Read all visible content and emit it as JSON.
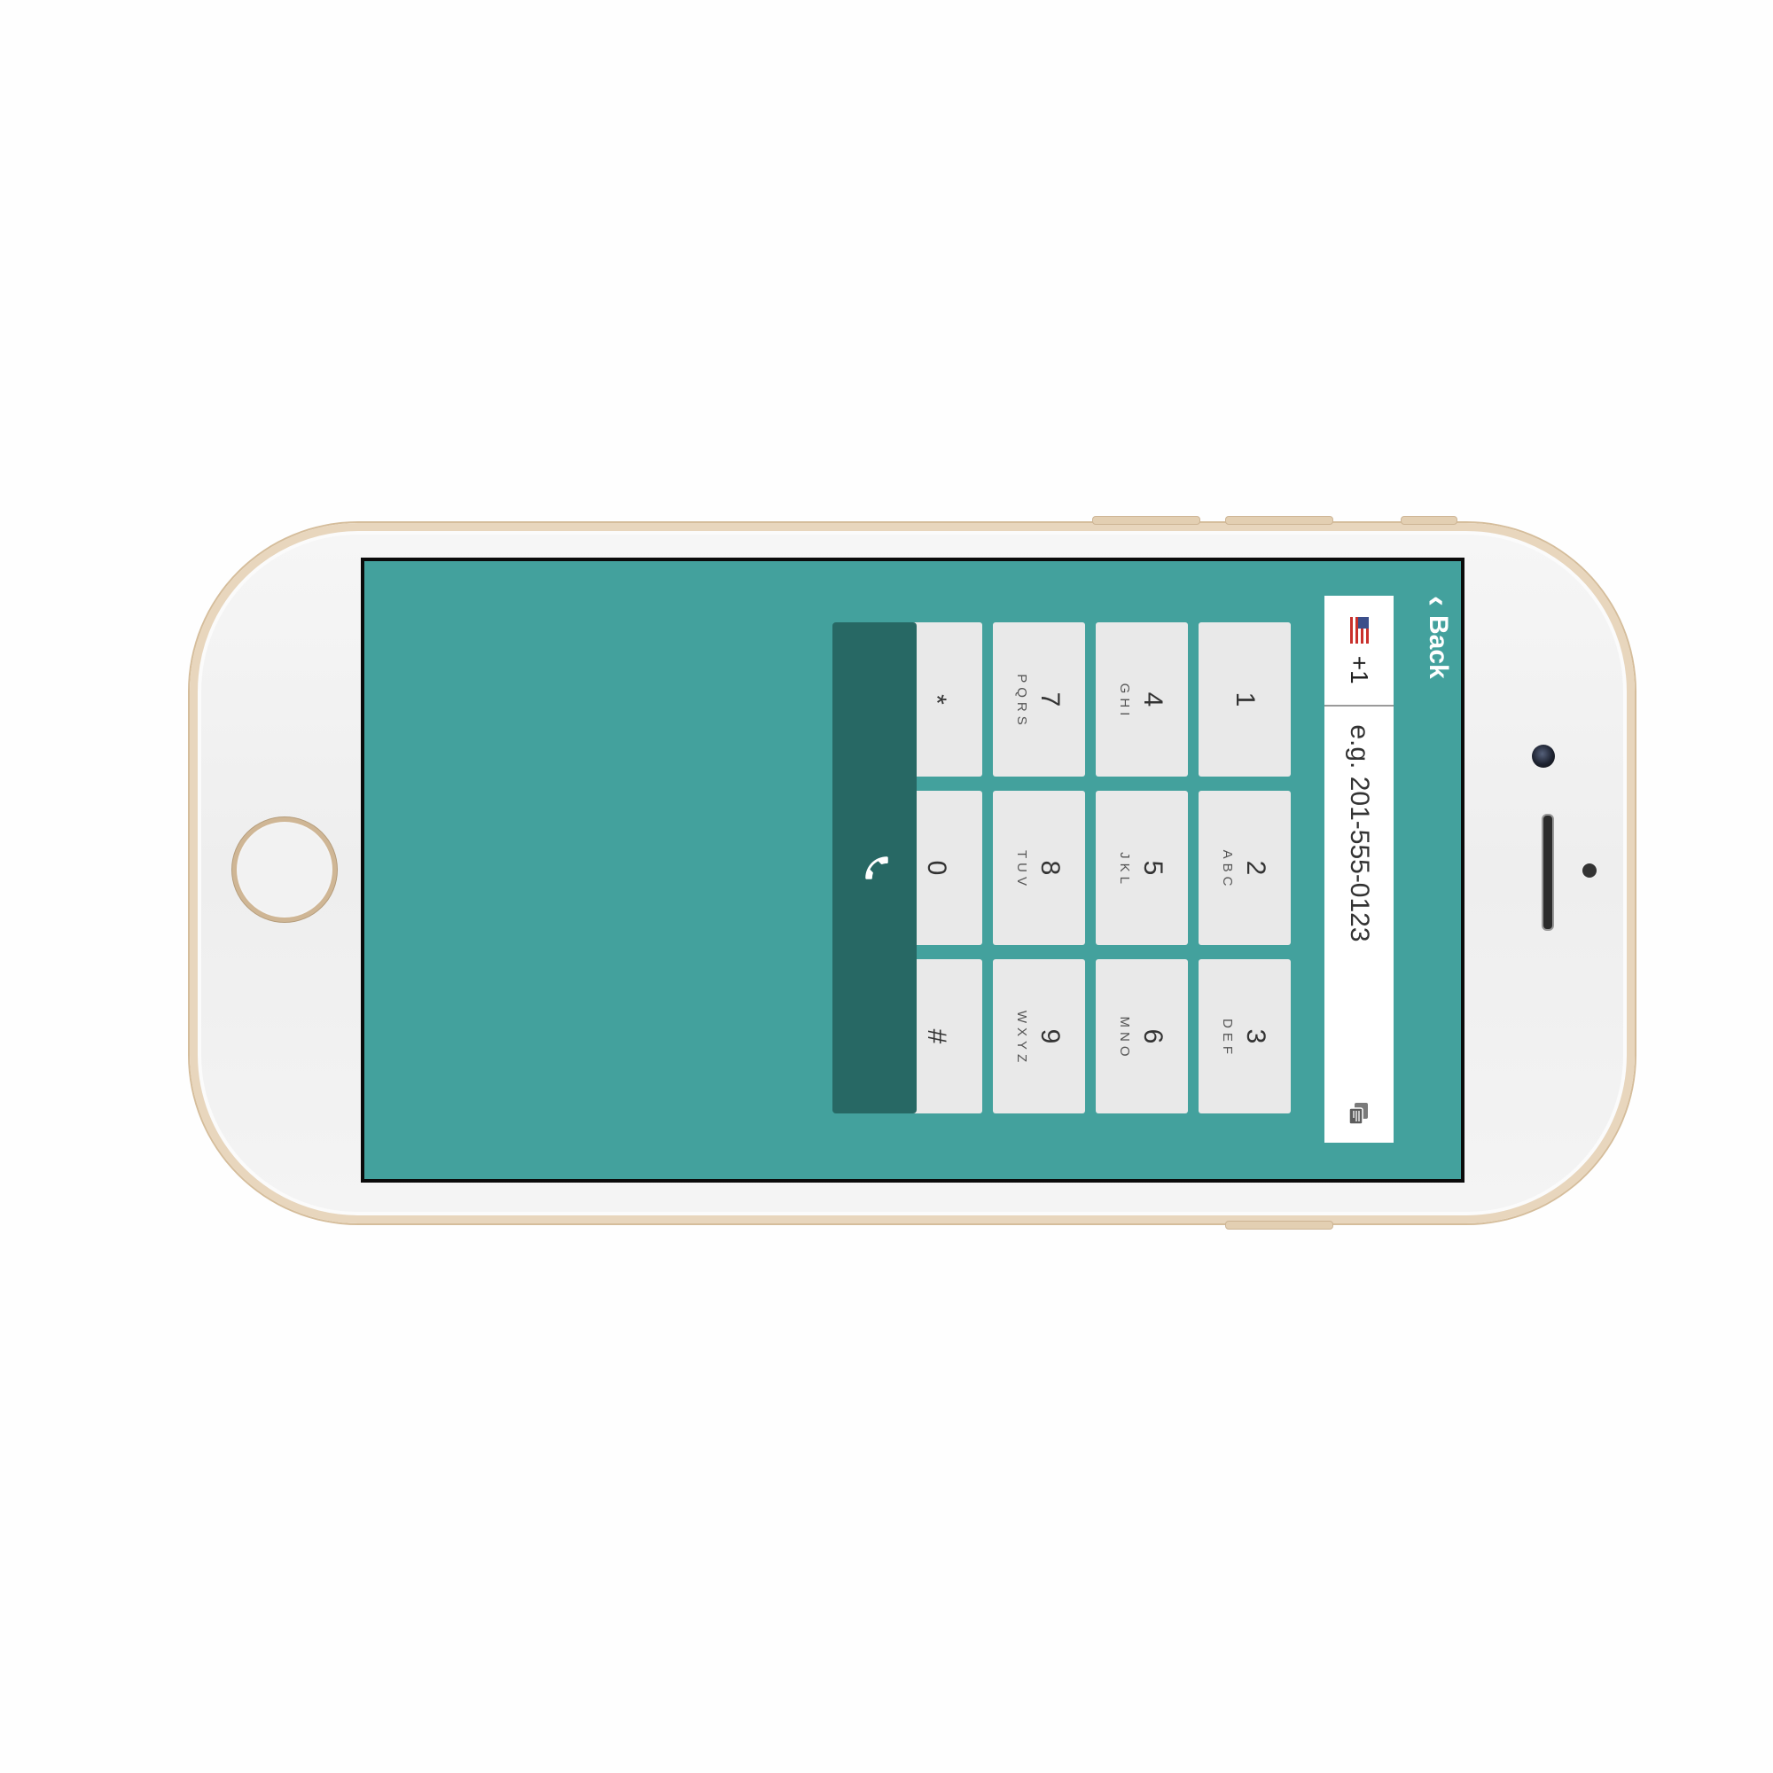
{
  "app": {
    "back_label": "Back",
    "country": {
      "flag_icon": "us-flag-icon",
      "dial_code": "+1"
    },
    "phone_input": {
      "placeholder": "e.g. 201-555-0123",
      "value": ""
    },
    "sms_icon": "sms-icon",
    "keypad": [
      {
        "digit": "1",
        "letters": ""
      },
      {
        "digit": "2",
        "letters": "ABC"
      },
      {
        "digit": "3",
        "letters": "DEF"
      },
      {
        "digit": "4",
        "letters": "GHI"
      },
      {
        "digit": "5",
        "letters": "JKL"
      },
      {
        "digit": "6",
        "letters": "MNO"
      },
      {
        "digit": "7",
        "letters": "PQRS"
      },
      {
        "digit": "8",
        "letters": "TUV"
      },
      {
        "digit": "9",
        "letters": "WXYZ"
      },
      {
        "digit": "*",
        "letters": ""
      },
      {
        "digit": "0",
        "letters": ""
      },
      {
        "digit": "#",
        "letters": ""
      }
    ],
    "call_icon": "phone-icon"
  },
  "colors": {
    "background": "#43a19d",
    "key": "#e9e9e9",
    "call_button": "#276864",
    "device_frame": "#e8d6bd"
  }
}
